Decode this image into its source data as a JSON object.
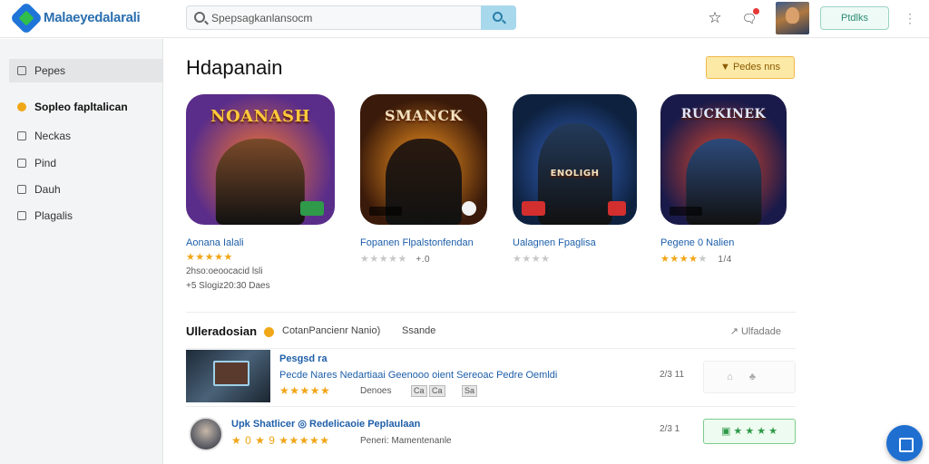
{
  "header": {
    "brand": "Malaeyedalarali",
    "search_placeholder": "Spepsagkanlansocm",
    "action_label": "Ptdlks",
    "kebab": "⋮",
    "star_icon": "☆",
    "chat_icon": "🗨"
  },
  "sidebar": {
    "items": [
      {
        "label": "Pepes",
        "icon": "square-icon"
      },
      {
        "label": "Sopleo fapltalican",
        "icon": "coin-icon"
      },
      {
        "label": "Neckas",
        "icon": "square-icon"
      },
      {
        "label": "Pind",
        "icon": "square-icon"
      },
      {
        "label": "Dauh",
        "icon": "square-icon"
      },
      {
        "label": "Plagalis",
        "icon": "square-icon"
      }
    ]
  },
  "main": {
    "heading": "Hdapanain",
    "pill_label": "▼ Pedes nns",
    "cards": [
      {
        "tile_text": "NOANASH",
        "name": "Aonana Ialali",
        "stars": "★★★★★",
        "stars_off": "",
        "rating_text": "",
        "meta1": "2hso:oeoocacid lsli",
        "meta2": "+5 Slogiz20:30 Daes",
        "colors": {
          "bg": "#5a2d8a",
          "glow": "#ff7a2a",
          "figure": "#7a4a2a"
        }
      },
      {
        "tile_text": "SMANCK",
        "name": "Fopanen Flpalstonfendan",
        "stars": "",
        "stars_off": "★★★★★",
        "rating_text": "+.0",
        "meta1": "",
        "meta2": "",
        "colors": {
          "bg": "#3a1a0a",
          "glow": "#ff9a20",
          "figure": "#2a1a10"
        }
      },
      {
        "tile_text": "ENOLIGH",
        "name": "Ualagnen Fpaglisa",
        "stars": "",
        "stars_off": "★★★★",
        "rating_text": "",
        "meta1": "",
        "meta2": "",
        "colors": {
          "bg": "#0e2240",
          "glow": "#3a6ad0",
          "figure": "#233a5a"
        }
      },
      {
        "tile_text": "RUCKINEK",
        "name": "Pegene 0 Nalien",
        "stars": "★★★★",
        "stars_off": "★",
        "rating_text": "1/4",
        "meta1": "",
        "meta2": "",
        "colors": {
          "bg": "#1a1a4a",
          "glow": "#e84a2a",
          "figure": "#2d4a7a"
        }
      }
    ]
  },
  "section": {
    "title": "Ulleradosian",
    "sub": "CotanPancienr Nanio)",
    "sub2": "Ssande",
    "link": "↗ Ulfadade"
  },
  "rows": [
    {
      "title": "Pesgsd ra",
      "desc": "Pecde Nares Nedartiaai  Geenooo oient  Sereoac Pedre Oemldi",
      "stars": "★★★★★",
      "meta": "Denoes",
      "tags": [
        "Ca",
        "Ca",
        "Sa"
      ],
      "count": "2/3 11",
      "ghost": "⌂♣"
    },
    {
      "title": "Upk Shatlicer ◎ Redelicaoie Peplaulaan",
      "desc": "",
      "stars": "★ 0 ★ 9  ★★★★★",
      "meta": "Peneri:   Mamentenanle",
      "tags": [],
      "count": "2/3 1",
      "btn": "▣ ★ ★ ★ ★"
    }
  ],
  "colors": {
    "accent": "#1f74d8",
    "brand_green": "#2fbf4a",
    "star": "#f2a516",
    "link": "#1c5ea8"
  }
}
